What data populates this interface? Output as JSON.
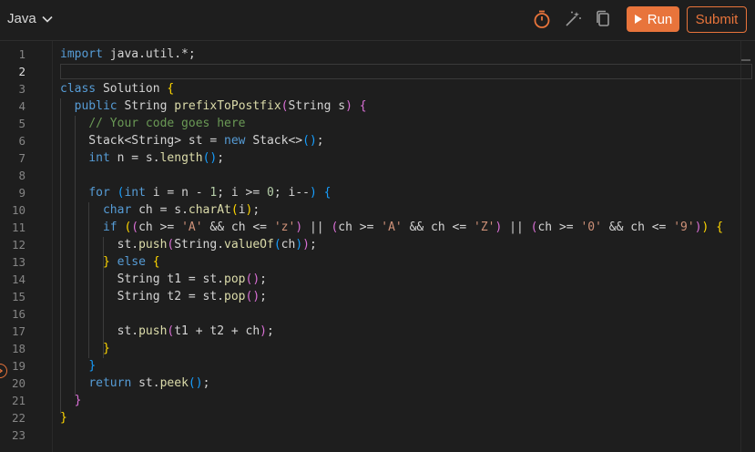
{
  "header": {
    "language": "Java",
    "run_label": "Run",
    "submit_label": "Submit",
    "icons": [
      "chevron-down-icon",
      "timer-icon",
      "magic-wand-icon",
      "copy-icon",
      "play-icon"
    ]
  },
  "colors": {
    "accent": "#e8743b",
    "background": "#1e1e1e"
  },
  "editor": {
    "active_line": 2,
    "line_numbers": [
      "1",
      "2",
      "3",
      "4",
      "5",
      "6",
      "7",
      "8",
      "9",
      "10",
      "11",
      "12",
      "13",
      "14",
      "15",
      "16",
      "17",
      "18",
      "19",
      "20",
      "21",
      "22",
      "23"
    ],
    "lines": [
      "import java.util.*;",
      "",
      "class Solution {",
      "  public String prefixToPostfix(String s) {",
      "    // Your code goes here",
      "    Stack<String> st = new Stack<>();",
      "    int n = s.length();",
      "",
      "    for (int i = n - 1; i >= 0; i--) {",
      "      char ch = s.charAt(i);",
      "      if ((ch >= 'A' && ch <= 'z') || (ch >= 'A' && ch <= 'Z') || (ch >= '0' && ch <= '9')) {",
      "        st.push(String.valueOf(ch));",
      "      } else {",
      "        String t1 = st.pop();",
      "        String t2 = st.pop();",
      "",
      "        st.push(t1 + t2 + ch);",
      "      }",
      "    }",
      "    return st.peek();",
      "  }",
      "}",
      ""
    ]
  }
}
